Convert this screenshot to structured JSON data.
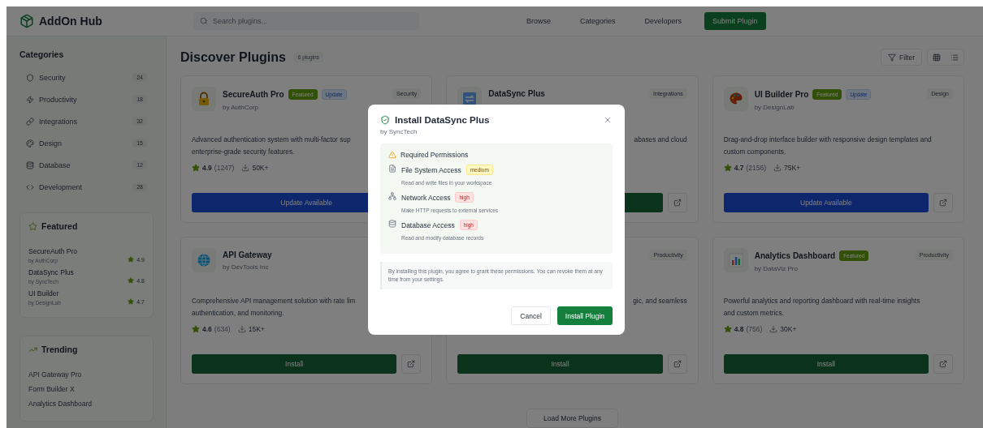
{
  "header": {
    "brand": "AddOn Hub",
    "search": {
      "placeholder": "Search plugins..."
    },
    "nav": [
      "Browse",
      "Categories",
      "Developers"
    ],
    "submit": "Submit Plugin"
  },
  "sidebar": {
    "title": "Categories",
    "categories": [
      {
        "label": "Security",
        "count": "24"
      },
      {
        "label": "Productivity",
        "count": "18"
      },
      {
        "label": "Integrations",
        "count": "32"
      },
      {
        "label": "Design",
        "count": "15"
      },
      {
        "label": "Database",
        "count": "12"
      },
      {
        "label": "Development",
        "count": "28"
      }
    ],
    "featured": {
      "title": "Featured",
      "items": [
        {
          "name": "SecureAuth Pro",
          "author": "by AuthCorp",
          "rating": "4.9"
        },
        {
          "name": "DataSync Plus",
          "author": "by SyncTech",
          "rating": "4.8"
        },
        {
          "name": "UI Builder",
          "author": "by DesignLab",
          "rating": "4.7"
        }
      ]
    },
    "trending": {
      "title": "Trending",
      "items": [
        "API Gateway Pro",
        "Form Builder X",
        "Analytics Dashboard"
      ]
    }
  },
  "main": {
    "title": "Discover Plugins",
    "count": "6 plugins",
    "filter": "Filter",
    "plugins": [
      {
        "title": "SecureAuth Pro",
        "author": "by AuthCorp",
        "badges": [
          {
            "kind": "featured",
            "label": "Featured"
          },
          {
            "kind": "update",
            "label": "Update"
          }
        ],
        "tag": "Security",
        "description_lines": [
          "Advanced authentication system with multi-factor sup",
          "enterprise-grade security features."
        ],
        "rating": "4.9",
        "reviews": "(1247)",
        "downloads": "50K+",
        "action": {
          "kind": "update",
          "label": "Update Available"
        }
      },
      {
        "title": "DataSync Plus",
        "tag": "Integrations",
        "description_fragment": "abases and cloud",
        "action": {
          "kind": "install"
        },
        "open_button": true
      },
      {
        "title": "UI Builder Pro",
        "author": "by DesignLab",
        "badges": [
          {
            "kind": "featured",
            "label": "Featured"
          },
          {
            "kind": "update",
            "label": "Update"
          }
        ],
        "tag": "Design",
        "description_lines": [
          "Drag-and-drop interface builder with responsive design templates and",
          "custom components."
        ],
        "rating": "4.7",
        "reviews": "(2156)",
        "downloads": "75K+",
        "action": {
          "kind": "update",
          "label": "Update Available"
        },
        "open_button": true
      },
      {
        "title": "API Gateway",
        "author": "by DevTools Inc",
        "description_lines": [
          "Comprehensive API management solution with rate lim",
          "authentication, and monitoring."
        ],
        "rating": "4.6",
        "reviews": "(634)",
        "downloads": "15K+",
        "action": {
          "kind": "install",
          "label": "Install"
        },
        "open_button": true
      },
      {
        "tag": "Productivity",
        "description_fragment": "gic, and seamless",
        "action": {
          "kind": "install",
          "label": "Install"
        },
        "open_button": true
      },
      {
        "title": "Analytics Dashboard",
        "author": "by DataViz Pro",
        "badges": [
          {
            "kind": "featured",
            "label": "Featured"
          }
        ],
        "tag": "Productivity",
        "description_lines": [
          "Powerful analytics and reporting dashboard with real-time insights",
          "and custom metrics."
        ],
        "rating": "4.8",
        "reviews": "(756)",
        "downloads": "30K+",
        "action": {
          "kind": "install",
          "label": "Install"
        },
        "open_button": true
      }
    ],
    "load_more": "Load More Plugins"
  },
  "dialog": {
    "title": "Install DataSync Plus",
    "subtitle": "by SyncTech",
    "permissions_title": "Required Permissions",
    "permissions": [
      {
        "name": "File System Access",
        "severity": "medium",
        "description": "Read and write files in your workspace"
      },
      {
        "name": "Network Access",
        "severity": "high",
        "description": "Make HTTP requests to external services"
      },
      {
        "name": "Database Access",
        "severity": "high",
        "description": "Read and modify database records"
      }
    ],
    "note": "By installing this plugin, you agree to grant these permissions. You can revoke them at any time from your settings.",
    "cancel": "Cancel",
    "confirm": "Install Plugin"
  }
}
